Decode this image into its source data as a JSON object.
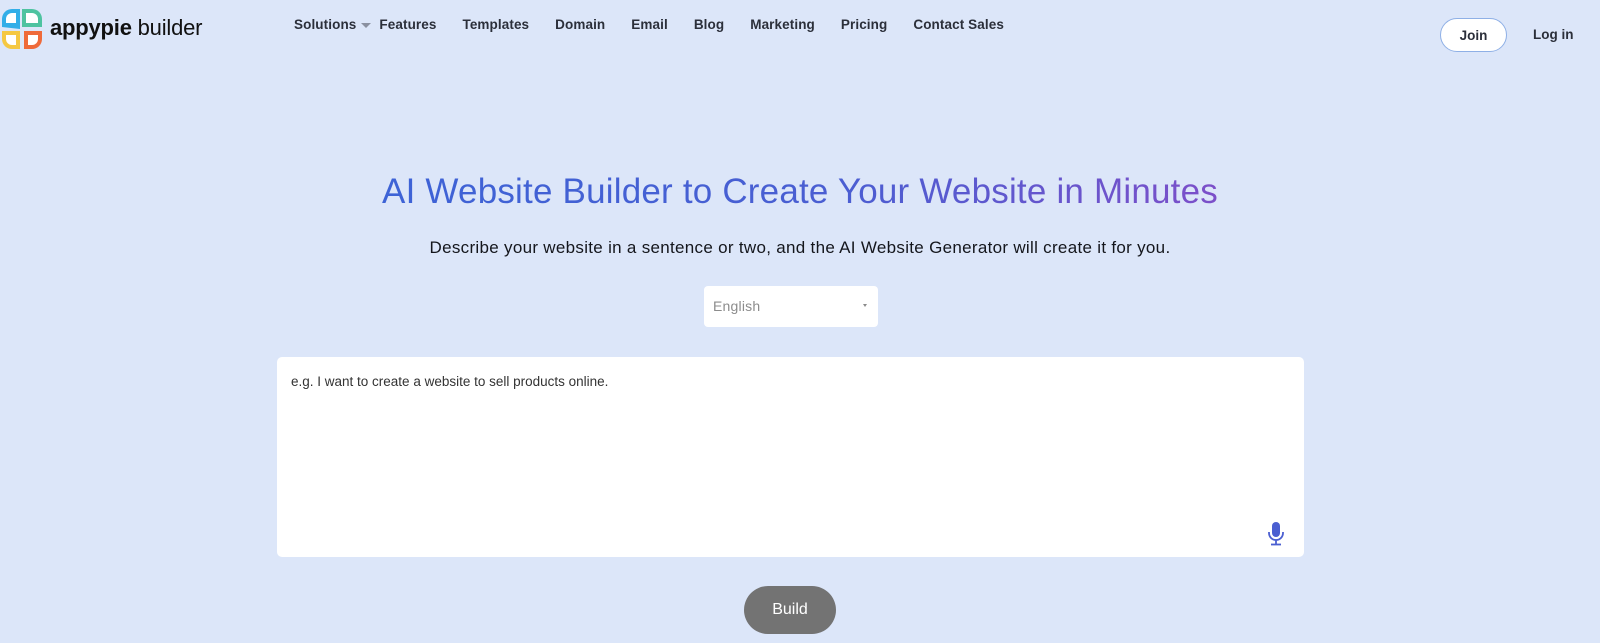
{
  "brand": {
    "name_bold": "appypie",
    "name_rest": " builder"
  },
  "nav": {
    "solutions": "Solutions",
    "items": [
      "Features",
      "Templates",
      "Domain",
      "Email",
      "Blog",
      "Marketing",
      "Pricing",
      "Contact Sales"
    ]
  },
  "account": {
    "join": "Join",
    "login": "Log in"
  },
  "hero": {
    "title": "AI Website Builder to Create Your Website in Minutes",
    "subtitle": "Describe your website in a sentence or two, and the AI Website Generator will create it for you."
  },
  "language": {
    "selected": "English"
  },
  "prompt": {
    "placeholder": "e.g. I want to create a website to sell products online."
  },
  "build_label": "Build",
  "colors": {
    "background": "#dce6f9",
    "title_gradient_start": "#3d63d6",
    "title_gradient_end": "#7c4fc9",
    "build_button": "#737373",
    "mic": "#4b5fd1"
  },
  "icons": {
    "logo": "appypie-clover-logo",
    "dropdown": "chevron-down-icon",
    "mic": "microphone-icon"
  }
}
